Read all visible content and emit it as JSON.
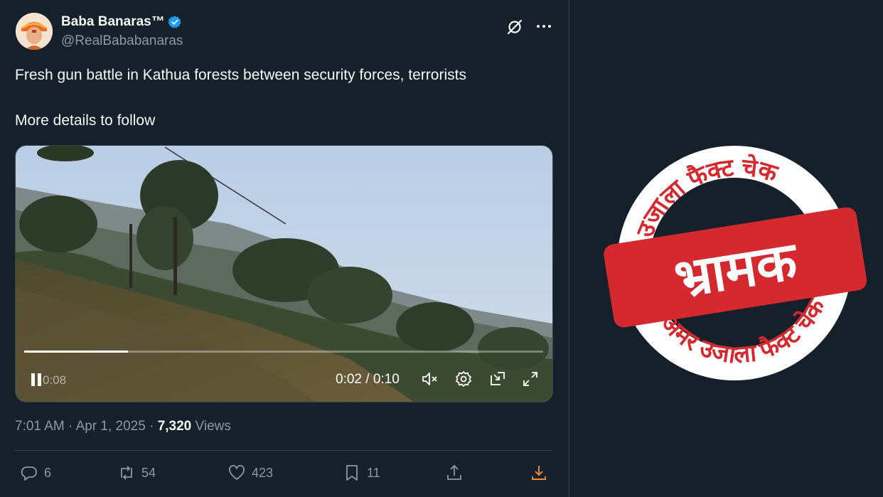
{
  "author": {
    "display_name": "Baba Banaras™",
    "handle": "@RealBababanaras"
  },
  "post": {
    "line1": "Fresh gun battle in Kathua forests between security forces, terrorists",
    "line2": "More details to follow"
  },
  "video": {
    "ghost_time": "0:08",
    "time_display": "0:02 / 0:10",
    "progress_fraction": 0.2
  },
  "meta": {
    "time": "7:01 AM",
    "date": "Apr 1, 2025",
    "views_count": "7,320",
    "views_label": "Views"
  },
  "actions": {
    "replies": "6",
    "reposts": "54",
    "likes": "423",
    "bookmarks": "11"
  },
  "stamp": {
    "verdict": "भ्रामक",
    "ring_top": "अमर उजाला फैक्ट चेक",
    "ring_bottom": "अमर उजाला फैक्ट चेक"
  },
  "colors": {
    "background": "#15202b",
    "text_primary": "#f7f9f9",
    "text_secondary": "#8b98a5",
    "verified": "#1d9bf0",
    "stamp_red": "#d42a2f",
    "download_accent": "#f18c3b"
  },
  "icons": [
    "verified-badge-icon",
    "grok-icon",
    "more-icon",
    "pause-icon",
    "mute-icon",
    "settings-icon",
    "pip-icon",
    "fullscreen-icon",
    "reply-icon",
    "repost-icon",
    "like-icon",
    "bookmark-icon",
    "share-icon",
    "download-icon"
  ]
}
